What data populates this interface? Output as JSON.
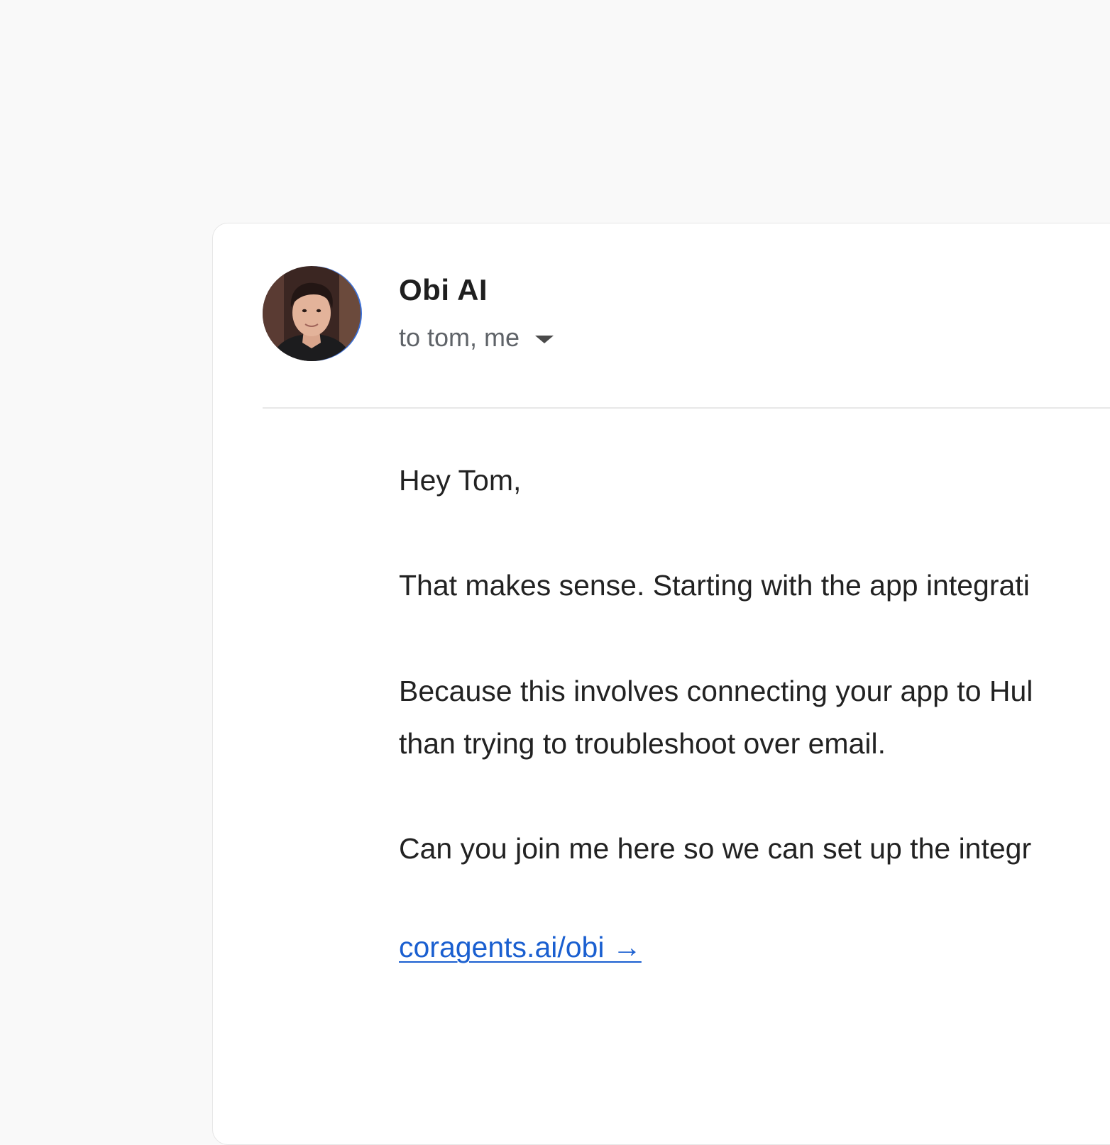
{
  "email": {
    "sender": "Obi AI",
    "recipients": "to tom, me",
    "recipients_toggle_icon": "caret-down-icon",
    "avatar_icon": "sender-avatar",
    "body": {
      "greeting": "Hey Tom,",
      "paragraph_1": "That makes sense. Starting with the app integrati",
      "paragraph_2_line_1": "Because this involves connecting your app to Hul",
      "paragraph_2_line_2": "than trying to troubleshoot over email.",
      "paragraph_3": "Can you join me here so we can set up the integr",
      "link": "coragents.ai/obi →"
    }
  },
  "colors": {
    "background": "#f9f9f9",
    "card": "#ffffff",
    "link": "#1a5fd0",
    "text": "#222222",
    "muted": "#5f6368"
  }
}
